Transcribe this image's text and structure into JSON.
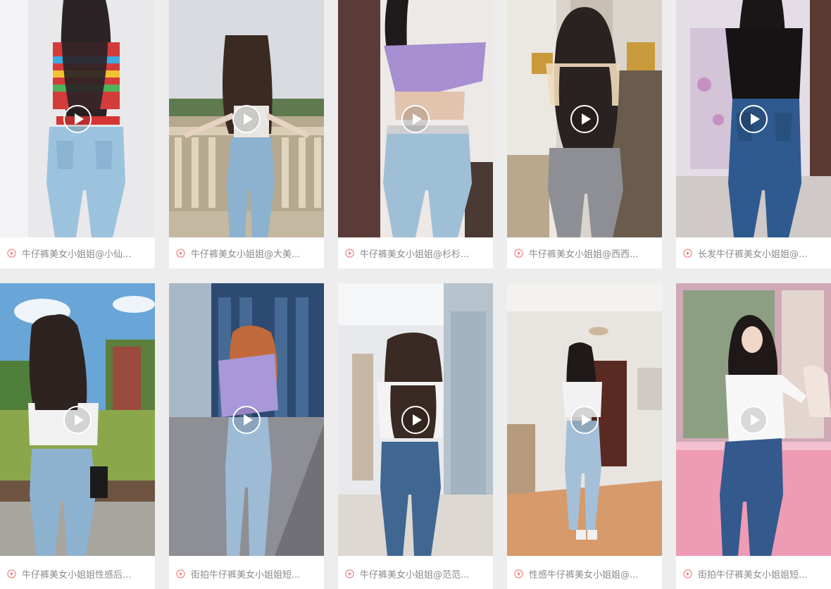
{
  "accent_color": "#f07c7c",
  "play_icon": "play-circle-icon",
  "caption_icon": "play-circle-outline-icon",
  "videos": [
    {
      "title": "牛仔裤美女小姐姐@小仙..."
    },
    {
      "title": "牛仔裤美女小姐姐@大美..."
    },
    {
      "title": "牛仔裤美女小姐姐@杉杉..."
    },
    {
      "title": "牛仔裤美女小姐姐@西西..."
    },
    {
      "title": "长发牛仔裤美女小姐姐@..."
    },
    {
      "title": "牛仔裤美女小姐姐性感后..."
    },
    {
      "title": "街拍牛仔裤美女小姐姐短..."
    },
    {
      "title": "牛仔裤美女小姐姐@范范..."
    },
    {
      "title": "性感牛仔裤美女小姐姐@..."
    },
    {
      "title": "街拍牛仔裤美女小姐姐短..."
    }
  ]
}
